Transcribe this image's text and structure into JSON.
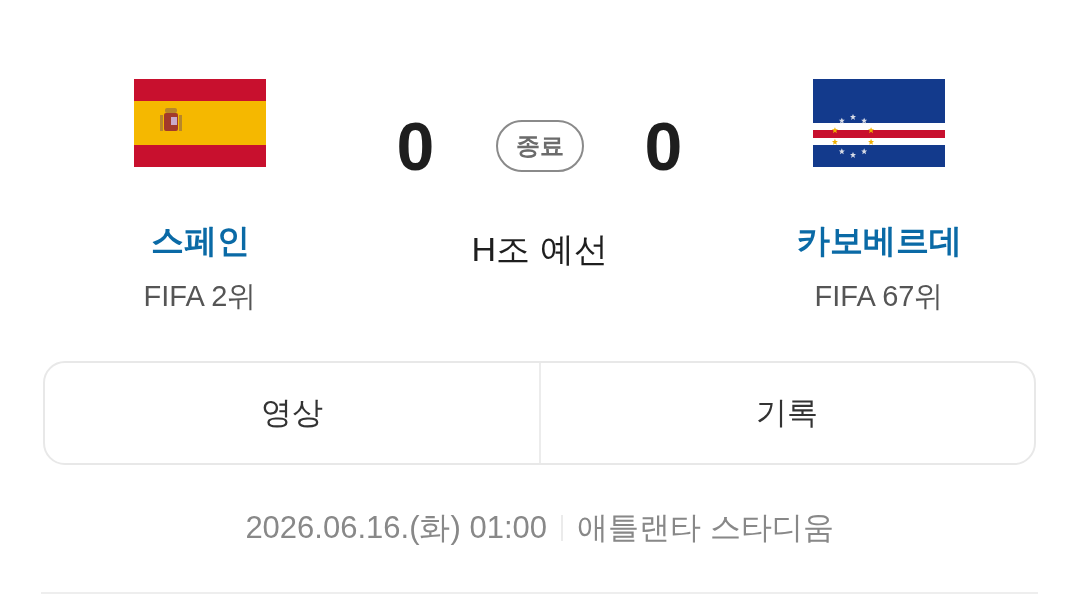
{
  "match": {
    "home": {
      "name": "스페인",
      "rank": "FIFA 2위",
      "score": "0"
    },
    "away": {
      "name": "카보베르데",
      "rank": "FIFA 67위",
      "score": "0"
    },
    "status": "종료",
    "stage": "H조 예선"
  },
  "buttons": [
    {
      "label": "영상"
    },
    {
      "label": "기록"
    }
  ],
  "info": {
    "datetime": "2026.06.16.(화) 01:00",
    "venue": "애틀랜타 스타디움"
  }
}
